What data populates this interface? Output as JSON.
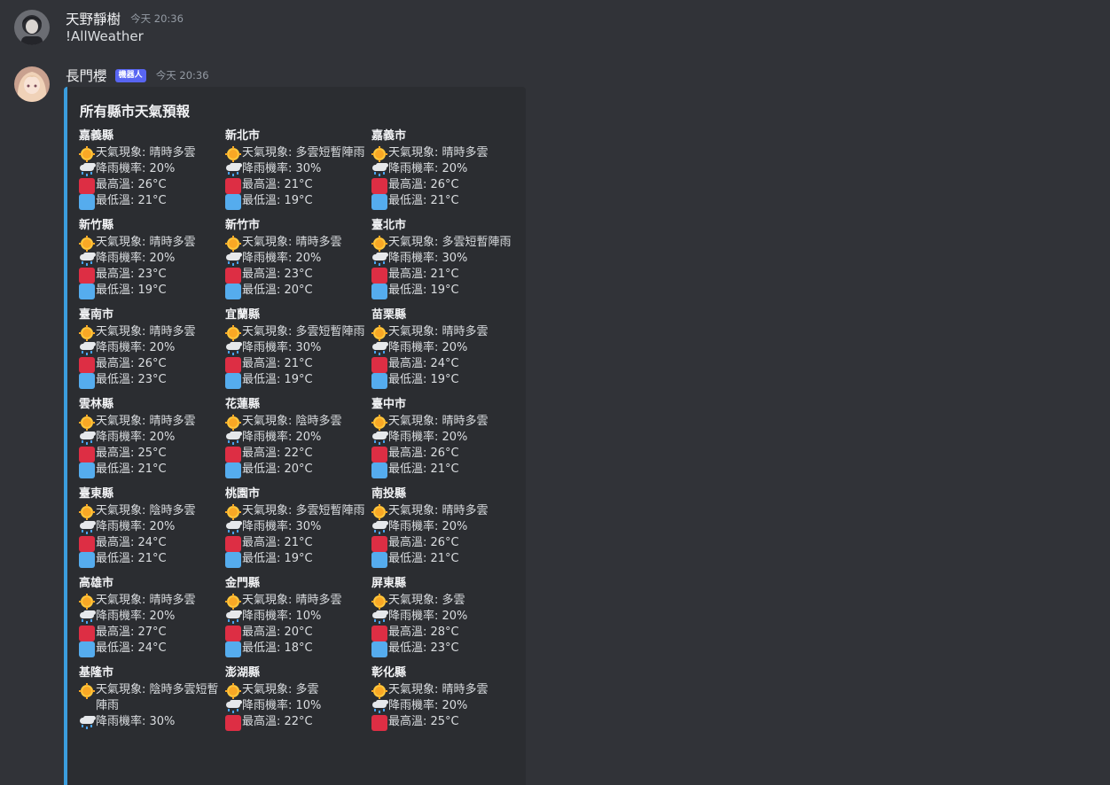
{
  "messages": [
    {
      "username": "天野靜樹",
      "timestamp": "今天 20:36",
      "text": "!AllWeather"
    },
    {
      "username": "長門櫻",
      "bot_tag": "機器人",
      "timestamp": "今天 20:36"
    }
  ],
  "embed": {
    "accent_color": "#3b9ddd",
    "title": "所有縣市天氣預報",
    "labels": {
      "phenomenon": "天氣現象: ",
      "rain": "降雨機率: ",
      "max": "最高溫: ",
      "min": "最低溫: "
    },
    "fields": [
      {
        "name": "嘉義縣",
        "phenomenon": "晴時多雲",
        "rain": "20%",
        "max": "26°C",
        "min": "21°C"
      },
      {
        "name": "新北市",
        "phenomenon": "多雲短暫陣雨",
        "rain": "30%",
        "max": "21°C",
        "min": "19°C"
      },
      {
        "name": "嘉義市",
        "phenomenon": "晴時多雲",
        "rain": "20%",
        "max": "26°C",
        "min": "21°C"
      },
      {
        "name": "新竹縣",
        "phenomenon": "晴時多雲",
        "rain": "20%",
        "max": "23°C",
        "min": "19°C"
      },
      {
        "name": "新竹市",
        "phenomenon": "晴時多雲",
        "rain": "20%",
        "max": "23°C",
        "min": "20°C"
      },
      {
        "name": "臺北市",
        "phenomenon": "多雲短暫陣雨",
        "rain": "30%",
        "max": "21°C",
        "min": "19°C"
      },
      {
        "name": "臺南市",
        "phenomenon": "晴時多雲",
        "rain": "20%",
        "max": "26°C",
        "min": "23°C"
      },
      {
        "name": "宜蘭縣",
        "phenomenon": "多雲短暫陣雨",
        "rain": "30%",
        "max": "21°C",
        "min": "19°C"
      },
      {
        "name": "苗栗縣",
        "phenomenon": "晴時多雲",
        "rain": "20%",
        "max": "24°C",
        "min": "19°C"
      },
      {
        "name": "雲林縣",
        "phenomenon": "晴時多雲",
        "rain": "20%",
        "max": "25°C",
        "min": "21°C"
      },
      {
        "name": "花蓮縣",
        "phenomenon": "陰時多雲",
        "rain": "20%",
        "max": "22°C",
        "min": "20°C"
      },
      {
        "name": "臺中市",
        "phenomenon": "晴時多雲",
        "rain": "20%",
        "max": "26°C",
        "min": "21°C"
      },
      {
        "name": "臺東縣",
        "phenomenon": "陰時多雲",
        "rain": "20%",
        "max": "24°C",
        "min": "21°C"
      },
      {
        "name": "桃園市",
        "phenomenon": "多雲短暫陣雨",
        "rain": "30%",
        "max": "21°C",
        "min": "19°C"
      },
      {
        "name": "南投縣",
        "phenomenon": "晴時多雲",
        "rain": "20%",
        "max": "26°C",
        "min": "21°C"
      },
      {
        "name": "高雄市",
        "phenomenon": "晴時多雲",
        "rain": "20%",
        "max": "27°C",
        "min": "24°C"
      },
      {
        "name": "金門縣",
        "phenomenon": "晴時多雲",
        "rain": "10%",
        "max": "20°C",
        "min": "18°C"
      },
      {
        "name": "屏東縣",
        "phenomenon": "多雲",
        "rain": "20%",
        "max": "28°C",
        "min": "23°C"
      },
      {
        "name": "基隆市",
        "phenomenon": "陰時多雲短暫陣雨",
        "rain": "30%"
      },
      {
        "name": "澎湖縣",
        "phenomenon": "多雲",
        "rain": "10%",
        "max": "22°C"
      },
      {
        "name": "彰化縣",
        "phenomenon": "晴時多雲",
        "rain": "20%",
        "max": "25°C"
      }
    ]
  },
  "icons": {
    "phenomenon": "sun-icon",
    "rain": "rain-cloud-icon",
    "max": "red-square-icon",
    "min": "blue-square-icon"
  }
}
